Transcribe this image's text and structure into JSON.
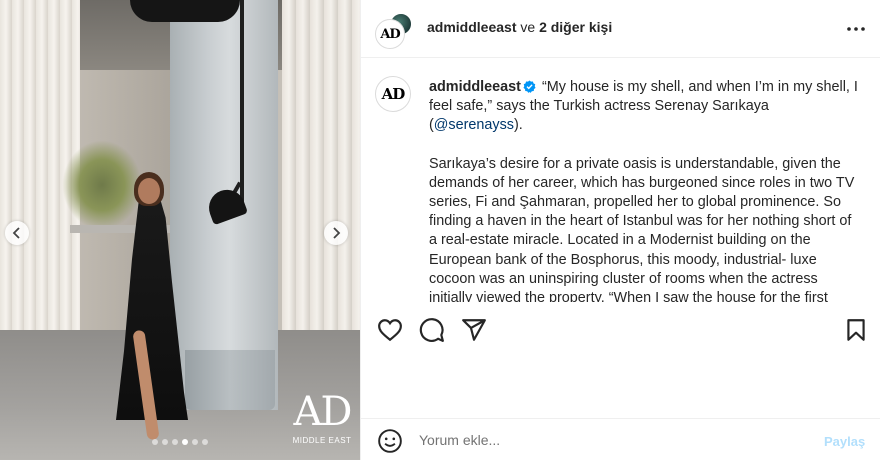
{
  "photo": {
    "logo_big": "AD",
    "logo_small": "MIDDLE EAST",
    "slide_count": 6,
    "active_slide": 4
  },
  "header": {
    "username": "admiddleeast",
    "suffix": " ve ",
    "others": "2 diğer kişi",
    "avatar_text": "AD"
  },
  "caption": {
    "avatar_text": "AD",
    "username": "admiddleeast",
    "para1_a": " “My house is my shell, and when I’m in my shell, I feel safe,” says the Turkish actress Serenay Sarıkaya (",
    "mention": "@serenayss",
    "para1_b": ").",
    "para2": "Sarıkaya’s desire for a private oasis is understandable, given the demands of her career, which has burgeoned since roles in two TV series, Fi and Şahmaran, propelled her to global prominence. So finding a haven in the heart of Istanbul was for her nothing short of a real-estate miracle. Located in a Modernist building on the European bank of the Bosphorus, this moody, industrial- luxe cocoon was an uninspiring cluster of rooms when the actress initially viewed the property. “When I saw the house for the first"
  },
  "comment": {
    "placeholder": "Yorum ekle...",
    "share_label": "Paylaş"
  },
  "colors": {
    "accent": "#0095f6",
    "share_disabled": "#b2dffc",
    "mention": "#00376b",
    "text": "#262626"
  }
}
